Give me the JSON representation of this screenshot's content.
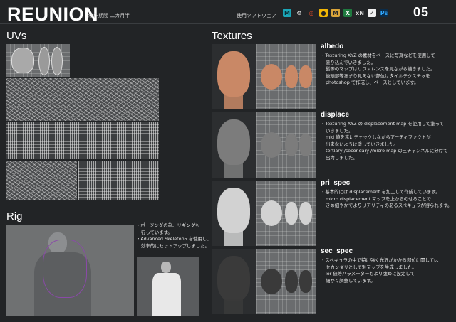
{
  "header": {
    "title": "REUNION",
    "period": "制作期間 二カ月半",
    "software_label": "使用ソフトウェア",
    "page_number": "05",
    "software_icons": [
      {
        "name": "maya-icon",
        "glyph": "M",
        "bg": "#1aa6b7",
        "fg": "#0b2f36"
      },
      {
        "name": "houdini-icon",
        "glyph": "⚙",
        "bg": "#222426",
        "fg": "#e7e7e7"
      },
      {
        "name": "substance-icon",
        "glyph": "◎",
        "bg": "#222426",
        "fg": "#e44b2a"
      },
      {
        "name": "arnold-icon",
        "glyph": "●",
        "bg": "#f2b705",
        "fg": "#222"
      },
      {
        "name": "mari-icon",
        "glyph": "M",
        "bg": "#d9a43a",
        "fg": "#2a2a2a"
      },
      {
        "name": "excel-icon",
        "glyph": "X",
        "bg": "#1f7a3f",
        "fg": "#ffffff"
      },
      {
        "name": "xnormal-icon",
        "glyph": "xN",
        "bg": "#222426",
        "fg": "#dddddd"
      },
      {
        "name": "vray-icon",
        "glyph": "✓",
        "bg": "#f0f0f0",
        "fg": "#222"
      },
      {
        "name": "photoshop-icon",
        "glyph": "Ps",
        "bg": "#0a2c4a",
        "fg": "#31a8ff"
      }
    ]
  },
  "sections": {
    "uvs": "UVs",
    "rig": "Rig",
    "textures": "Textures"
  },
  "rig": {
    "lines": [
      "・ポージングの為、リギングも",
      "行っています。",
      "・Advanced Skeleton5 を使用し、",
      "効率的にセットアップしました。"
    ]
  },
  "textures": [
    {
      "name": "albedo",
      "skin": "#c98866",
      "lines": [
        "・Texturing XYZ の素材をベースに写真などを使用して",
        "塗り込んでいきました。",
        "髭等のマップはリファレンスを見ながら描きました。",
        "後頭部等あまり見えない部位はタイルテクスチャを",
        "photoshop で作成し、ベースとしています。"
      ]
    },
    {
      "name": "displace",
      "skin": "#7c7c7c",
      "lines": [
        "・Texturing XYZ の displacement map を使用して塗って",
        "いきました。",
        "mid 値を常にチェックしながらアーティファクトが",
        "出来ないように塗っていきました。",
        "tertiary /secondary /micro map の三チャンネルに分けて",
        "出力しました。"
      ]
    },
    {
      "name": "pri_spec",
      "skin": "#d2d2d2",
      "lines": [
        "・基本的には displacement を加工して作成しています。",
        "micro displacement マップを上からのせることで",
        "きめ細やかでよりリアリティのあるスペキュラが得られます。"
      ]
    },
    {
      "name": "sec_spec",
      "skin": "#3a3a3a",
      "lines": [
        "・スペキュラの中で特に強く光沢がかかる部位に関しては",
        "セカンダリとして別マップを生成しました。",
        "ior 値等パラメーターもより強めに設定して",
        "細かく調整しています。"
      ]
    }
  ]
}
